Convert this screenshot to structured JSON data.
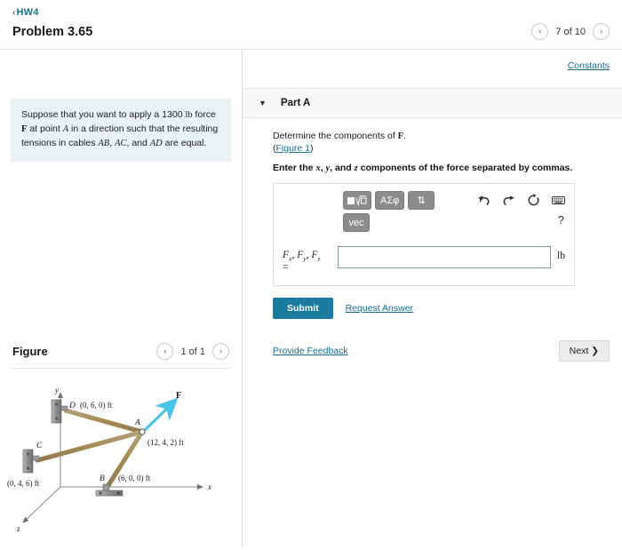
{
  "header": {
    "back_label": "HW4",
    "back_chevron": "‹",
    "title": "Problem 3.65",
    "pager_text": "7 of 10",
    "prev_icon": "‹",
    "next_icon": "›"
  },
  "left": {
    "problem_text_parts": {
      "p1": "Suppose that you want to apply a 1300 ",
      "unit": "lb",
      "p2": " force ",
      "force_symbol": "F",
      "p3": " at point ",
      "point_a": "A",
      "p4": " in a direction such that the resulting tensions in cables ",
      "cable_ab": "AB",
      "sep1": ", ",
      "cable_ac": "AC",
      "sep2": ", and ",
      "cable_ad": "AD",
      "p5": " are equal."
    },
    "figure": {
      "label": "Figure",
      "pager_text": "1 of 1",
      "prev_icon": "‹",
      "next_icon": "›",
      "axes": {
        "x": "x",
        "y": "y",
        "z": "z"
      },
      "points": [
        {
          "name": "D",
          "coord": "(0, 6, 0) ft"
        },
        {
          "name": "C",
          "coord": "(0, 4, 6) ft"
        },
        {
          "name": "B",
          "coord": "(6, 0, 0) ft"
        },
        {
          "name": "A",
          "coord": "(12, 4, 2) ft"
        }
      ],
      "force_label": "F",
      "force_color": "#4cc2e8",
      "cable_color": "#c9ad79"
    }
  },
  "right": {
    "constants_label": "Constants",
    "part": {
      "caret_icon": "▼",
      "title": "Part A",
      "question_pre": "Determine the components of ",
      "question_symbol": "F",
      "question_post": ".",
      "figure_ref": "Figure 1",
      "figure_ref_open": "(",
      "figure_ref_close": ")",
      "instruction_parts": {
        "p1": "Enter the ",
        "x": "x",
        "p2": ", ",
        "y": "y",
        "p3": ", and ",
        "z": "z",
        "p4": " components of the force separated by commas."
      }
    },
    "toolbar": {
      "template_label": "√",
      "greek_label": "ΑΣφ",
      "arrows_label": "⇅",
      "vec_label": "vec",
      "help_label": "?",
      "icons": [
        "undo-icon",
        "redo-icon",
        "reset-icon",
        "keyboard-icon"
      ]
    },
    "answer": {
      "label_line1": "F",
      "label_sub_x": "x",
      "label_sub_y": "y",
      "label_sub_z": "z",
      "label_eq": "=",
      "value": "",
      "placeholder": "",
      "unit": "lb"
    },
    "actions": {
      "submit_label": "Submit",
      "request_answer_label": "Request Answer",
      "provide_feedback_label": "Provide Feedback",
      "next_label": "Next",
      "next_icon": "❯"
    },
    "accent_color": "#1b7b9e"
  }
}
